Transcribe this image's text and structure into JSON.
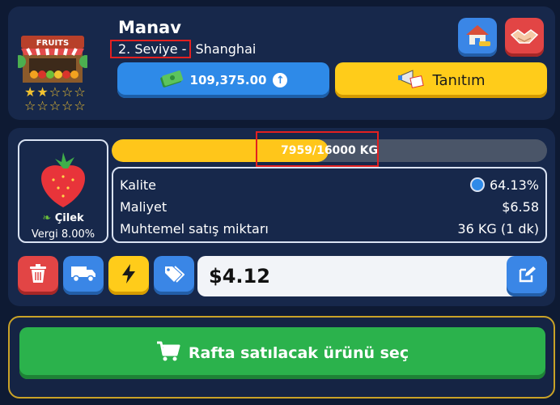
{
  "shop": {
    "name": "Manav",
    "level": "2. Seviye -",
    "city": " Shanghai",
    "stars_row1": "★★☆☆☆",
    "stars_row2": "☆☆☆☆☆",
    "sign": "FRUITS"
  },
  "money": {
    "amount": "109,375.00"
  },
  "promo": {
    "label": "Tanıtım"
  },
  "product": {
    "name": "Çilek",
    "tax": "Vergi 8.00%",
    "stock_text": "7959/16000 KG",
    "stock_fraction": 0.4974
  },
  "stats": {
    "quality_label": "Kalite",
    "quality_value": "64.13%",
    "cost_label": "Maliyet",
    "cost_value": "$6.58",
    "sales_label": "Muhtemel satış miktarı",
    "sales_value": "36 KG (1 dk)"
  },
  "price": {
    "value": "$4.12"
  },
  "main_action": {
    "label": "Rafta satılacak ürünü seç"
  },
  "colors": {
    "background": "#0e1a33",
    "panel": "#17284b",
    "blue": "#3a86e6",
    "yellow": "#ffcc1a",
    "red": "#e24545",
    "green": "#2bb24c",
    "highlight": "#e32020"
  }
}
